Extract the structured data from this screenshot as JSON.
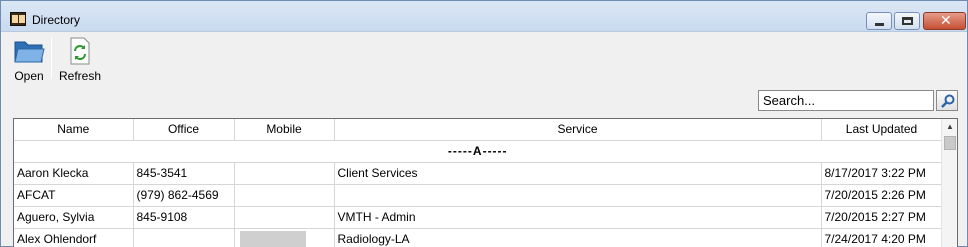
{
  "window": {
    "title": "Directory",
    "controls": {
      "minimize": "minimize",
      "maximize": "maximize",
      "close": "✕"
    }
  },
  "toolbar": {
    "open_label": "Open",
    "refresh_label": "Refresh"
  },
  "search": {
    "placeholder": "Search...",
    "icon": "search-icon"
  },
  "table": {
    "columns": [
      "Name",
      "Office",
      "Mobile",
      "Service",
      "Last Updated"
    ],
    "group_header": "-----A-----",
    "rows": [
      {
        "name": "Aaron Klecka",
        "office": "845-3541",
        "mobile": "",
        "service": "Client Services",
        "updated": "8/17/2017 3:22 PM"
      },
      {
        "name": "AFCAT",
        "office": "(979) 862-4569",
        "mobile": "",
        "service": "",
        "updated": "7/20/2015 2:26 PM"
      },
      {
        "name": "Aguero, Sylvia",
        "office": "845-9108",
        "mobile": "",
        "service": "VMTH - Admin",
        "updated": "7/20/2015 2:27 PM"
      },
      {
        "name": "Alex Ohlendorf",
        "office": "",
        "mobile": "",
        "service": "Radiology-LA",
        "updated": "7/24/2017 4:20 PM"
      }
    ]
  },
  "colors": {
    "title_bar": "#c9daef",
    "close_button": "#c44f35",
    "grid_border": "#6d6d6d"
  }
}
